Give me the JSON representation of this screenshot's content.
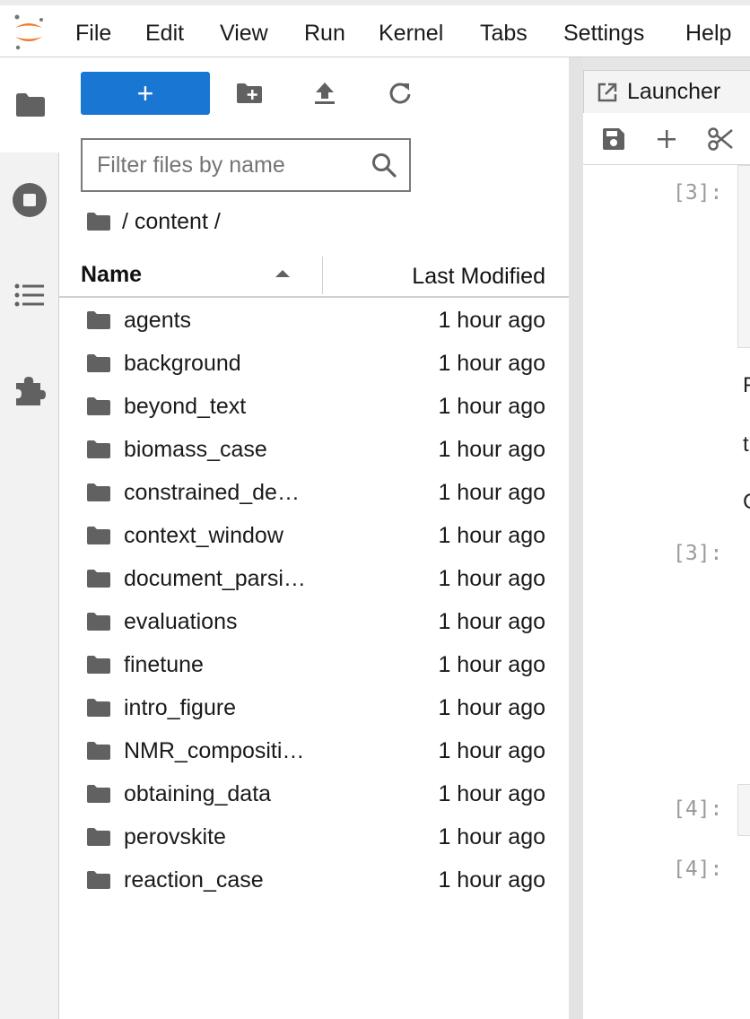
{
  "menu": [
    "File",
    "Edit",
    "View",
    "Run",
    "Kernel",
    "Tabs",
    "Settings",
    "Help"
  ],
  "sidebar_icons": [
    "folder-icon",
    "running-stop-icon",
    "table-of-contents-icon",
    "extension-puzzle-icon"
  ],
  "toolbar": {
    "new_label": "+",
    "icons": [
      "new-folder-icon",
      "upload-icon",
      "refresh-icon"
    ]
  },
  "filter": {
    "placeholder": "Filter files by name",
    "value": ""
  },
  "breadcrumb": "/ content /",
  "columns": {
    "name": "Name",
    "modified": "Last Modified"
  },
  "files": [
    {
      "name": "agents",
      "modified": "1 hour ago"
    },
    {
      "name": "background",
      "modified": "1 hour ago"
    },
    {
      "name": "beyond_text",
      "modified": "1 hour ago"
    },
    {
      "name": "biomass_case",
      "modified": "1 hour ago"
    },
    {
      "name": "constrained_de…",
      "modified": "1 hour ago"
    },
    {
      "name": "context_window",
      "modified": "1 hour ago"
    },
    {
      "name": "document_parsi…",
      "modified": "1 hour ago"
    },
    {
      "name": "evaluations",
      "modified": "1 hour ago"
    },
    {
      "name": "finetune",
      "modified": "1 hour ago"
    },
    {
      "name": "intro_figure",
      "modified": "1 hour ago"
    },
    {
      "name": "NMR_compositi…",
      "modified": "1 hour ago"
    },
    {
      "name": "obtaining_data",
      "modified": "1 hour ago"
    },
    {
      "name": "perovskite",
      "modified": "1 hour ago"
    },
    {
      "name": "reaction_case",
      "modified": "1 hour ago"
    }
  ],
  "main": {
    "tab_label": "Launcher",
    "notebook_tools": [
      "save-icon",
      "add-cell-icon",
      "cut-icon"
    ],
    "prompts": [
      "[3]:",
      "[3]:",
      "[4]:",
      "[4]:"
    ],
    "partial_chars": [
      "F",
      "t",
      "C"
    ]
  },
  "colors": {
    "accent": "#1976d2",
    "logo_orange": "#f37726",
    "icon_gray": "#616161"
  }
}
